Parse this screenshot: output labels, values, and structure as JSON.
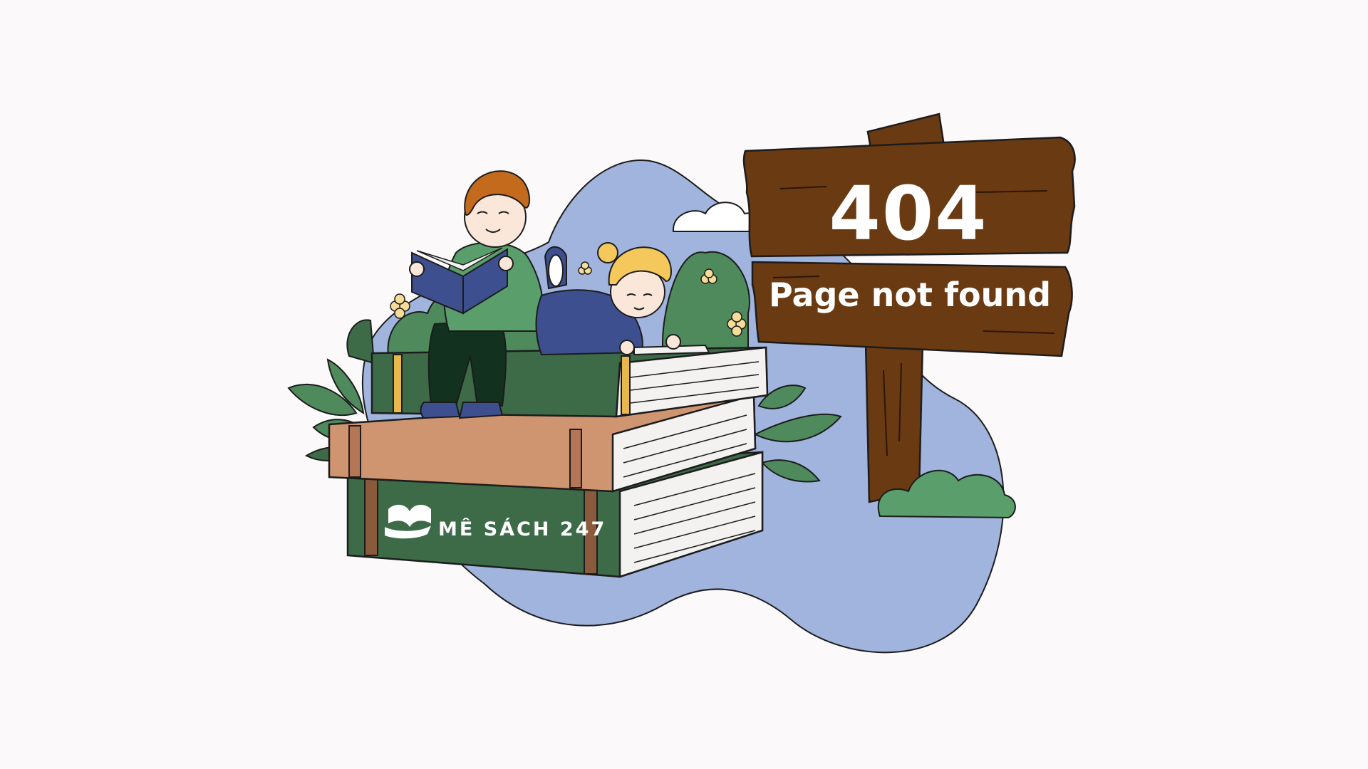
{
  "error": {
    "code": "404",
    "message": "Page not found"
  },
  "brand": {
    "logo_text": "MÊ SÁCH 247",
    "logo_icon": "open-book-hand-icon"
  },
  "colors": {
    "background": "#fbf9fa",
    "blob": "#a1b4dd",
    "sign_wood": "#6a3a12",
    "sign_text": "#ffffff",
    "book_green": "#3d6b48",
    "book_tan": "#cf9571"
  }
}
